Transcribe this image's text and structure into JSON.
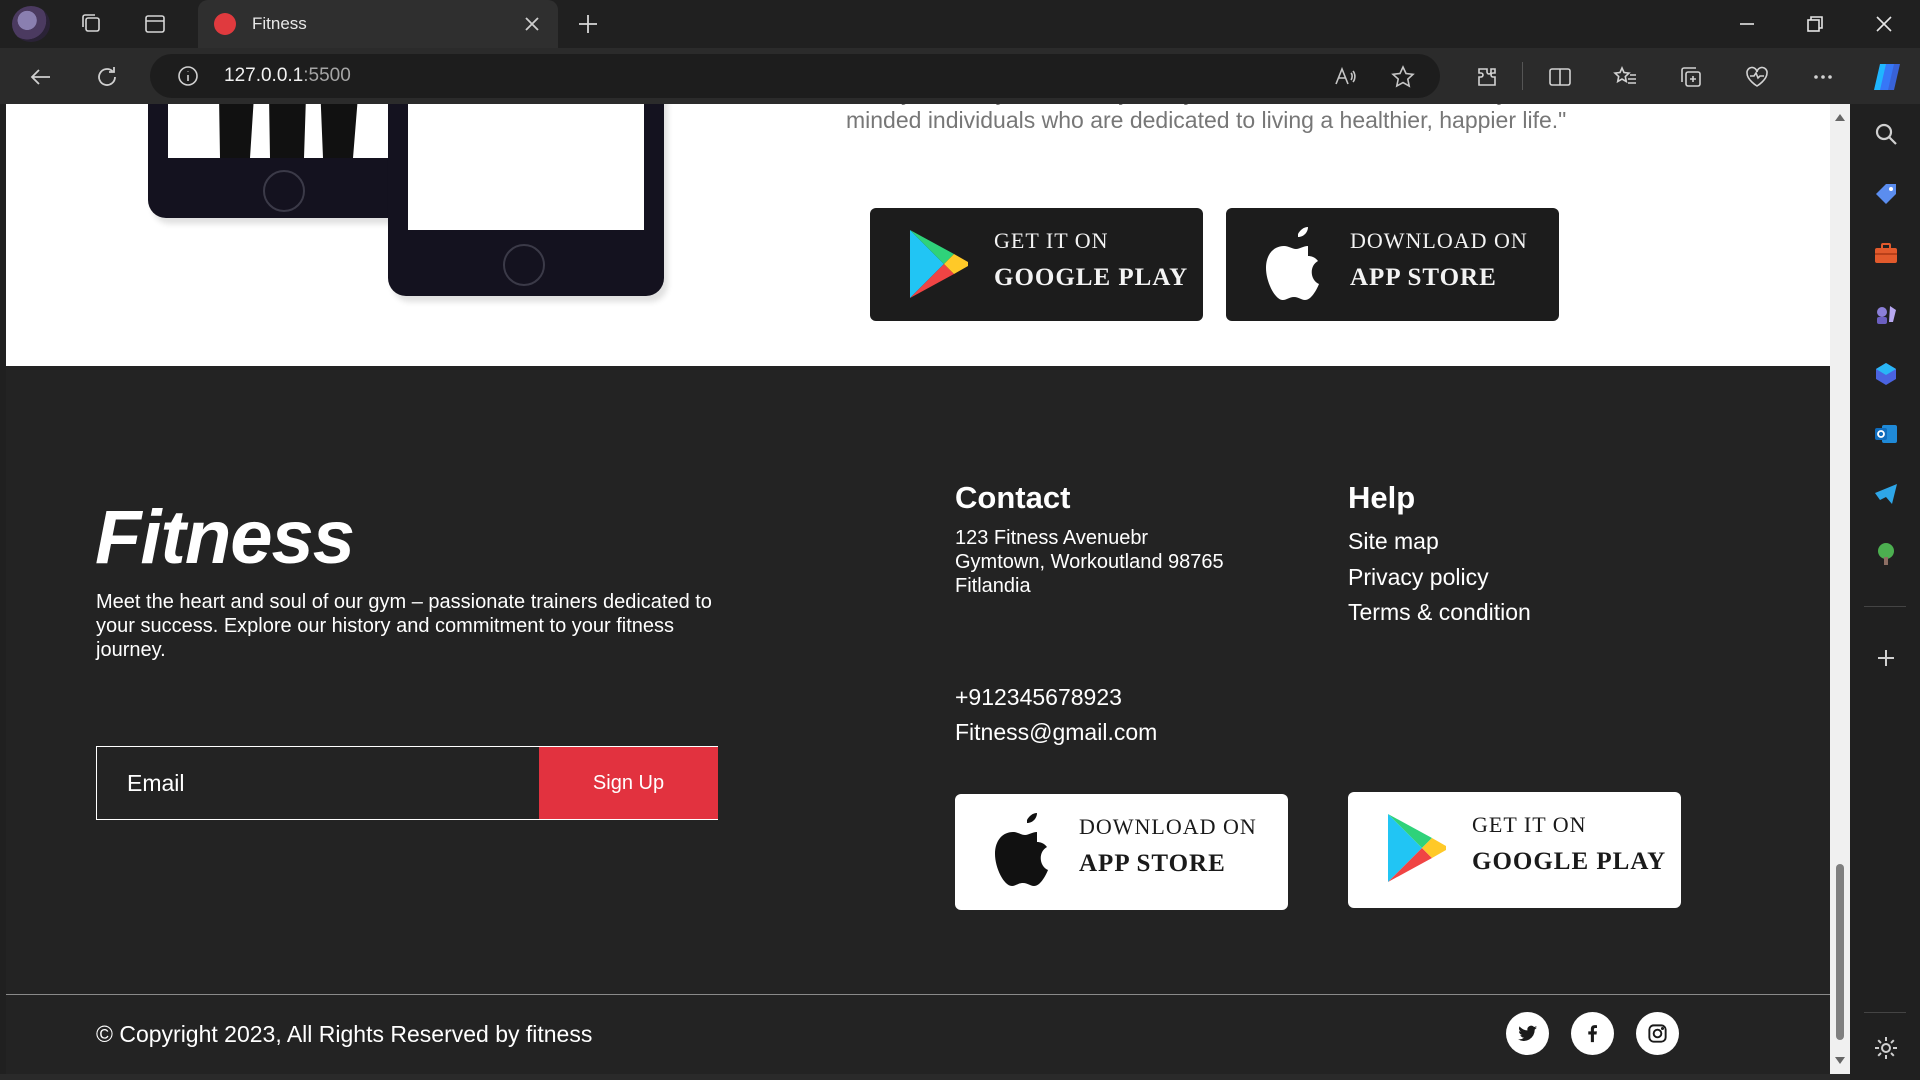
{
  "browser": {
    "tab_title": "Fitness",
    "url_host": "127.0.0.1",
    "url_port": ":5500"
  },
  "hero": {
    "text": "Ready to start your fitness journey? Join our inclusive community of like-minded individuals who are dedicated to living a healthier, happier life.\"",
    "google_play": {
      "small": "GET IT ON",
      "big": "GOOGLE PLAY"
    },
    "app_store": {
      "small": "DOWNLOAD  ON",
      "big": "APP STORE"
    }
  },
  "footer": {
    "brand": "Fitness",
    "about": "Meet the heart and soul of our gym – passionate trainers dedicated to your success. Explore our history and commitment to your fitness journey.",
    "email_placeholder": "Email",
    "signup_label": "Sign Up",
    "contact": {
      "heading": "Contact",
      "address_line1": "123 Fitness Avenuebr",
      "address_line2": "Gymtown, Workoutland 98765",
      "address_line3": "Fitlandia",
      "phone": "+912345678923",
      "email": "Fitness@gmail.com"
    },
    "help": {
      "heading": "Help",
      "links": [
        "Site map",
        "Privacy policy",
        "Terms & condition"
      ]
    },
    "app_store": {
      "small": "DOWNLOAD  ON",
      "big": "APP STORE"
    },
    "google_play": {
      "small": "GET IT ON",
      "big": "GOOGLE PLAY"
    },
    "copyright": "© Copyright 2023, All Rights Reserved by fitness",
    "social": [
      "twitter-icon",
      "facebook-icon",
      "instagram-icon"
    ]
  },
  "colors": {
    "accent": "#e2323f",
    "footer_bg": "#232323",
    "chrome_bg": "#202020"
  }
}
